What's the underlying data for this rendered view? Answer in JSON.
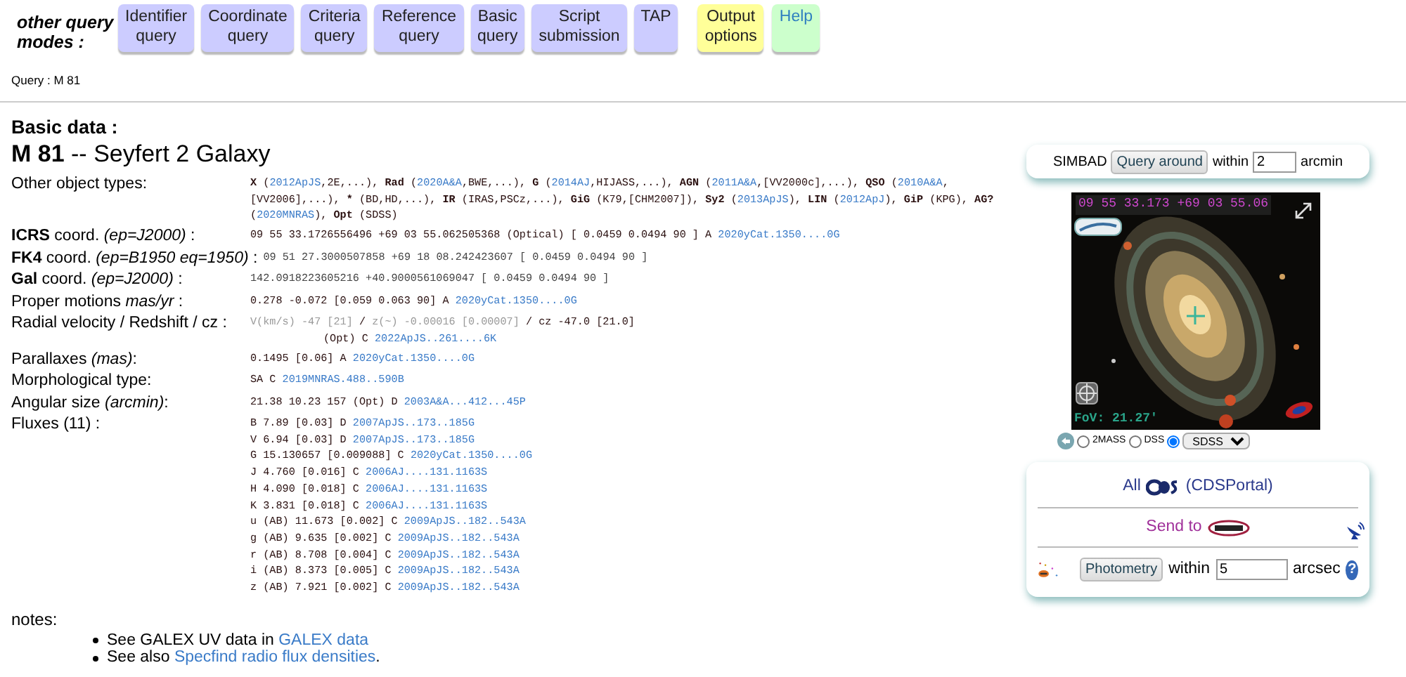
{
  "header": {
    "modes_label": "other query modes :",
    "buttons": [
      {
        "label": "Identifier query",
        "kind": "query",
        "color": "#ccccff"
      },
      {
        "label": "Coordinate query",
        "kind": "query",
        "color": "#ccccff"
      },
      {
        "label": "Criteria query",
        "kind": "query",
        "color": "#ccccff"
      },
      {
        "label": "Reference query",
        "kind": "query",
        "color": "#ccccff"
      },
      {
        "label": "Basic query",
        "kind": "query",
        "color": "#ccccff"
      },
      {
        "label": "Script submission",
        "kind": "query",
        "color": "#ccccff"
      },
      {
        "label": "TAP",
        "kind": "query",
        "color": "#ccccff"
      },
      {
        "label": "Output options",
        "kind": "options",
        "color": "#ffff99"
      },
      {
        "label": "Help",
        "kind": "help",
        "color": "#ccffcc"
      }
    ]
  },
  "query": "Query : M 81",
  "basic_data": {
    "heading": "Basic data :",
    "title": "**M 81** -- Seyfert 2 Galaxy",
    "rows": [
      {
        "label": "Other object types:",
        "lines": [
          {
            "indent": false,
            "segments": [
              {
                "kind": "bold",
                "text": "X"
              },
              {
                "kind": "text",
                "text": " ("
              },
              {
                "kind": "link",
                "text": "2012ApJS"
              },
              {
                "kind": "text",
                "text": ",2E,...), "
              },
              {
                "kind": "bold",
                "text": "Rad"
              },
              {
                "kind": "text",
                "text": " ("
              },
              {
                "kind": "link",
                "text": "2020A&A"
              },
              {
                "kind": "text",
                "text": ",BWE,...), "
              },
              {
                "kind": "bold",
                "text": "G"
              },
              {
                "kind": "text",
                "text": " ("
              },
              {
                "kind": "link",
                "text": "2014AJ"
              },
              {
                "kind": "text",
                "text": ",HIJASS,...), "
              },
              {
                "kind": "bold",
                "text": "AGN"
              },
              {
                "kind": "text",
                "text": " ("
              },
              {
                "kind": "link",
                "text": "2011A&A"
              },
              {
                "kind": "text",
                "text": ",[VV2000c],...), "
              },
              {
                "kind": "bold",
                "text": "QSO"
              },
              {
                "kind": "text",
                "text": " ("
              },
              {
                "kind": "link",
                "text": "2010A&A"
              },
              {
                "kind": "text",
                "text": ",[VV2006],...), "
              },
              {
                "kind": "bold",
                "text": "*"
              },
              {
                "kind": "text",
                "text": " (BD,HD,...), "
              },
              {
                "kind": "bold",
                "text": "IR"
              },
              {
                "kind": "text",
                "text": " (IRAS,PSCz,...), "
              },
              {
                "kind": "bold",
                "text": "GiG"
              },
              {
                "kind": "text",
                "text": " (K79,[CHM2007]), "
              },
              {
                "kind": "bold",
                "text": "Sy2"
              },
              {
                "kind": "text",
                "text": " ("
              },
              {
                "kind": "link",
                "text": "2013ApJS"
              },
              {
                "kind": "text",
                "text": "), "
              },
              {
                "kind": "bold",
                "text": "LIN"
              },
              {
                "kind": "text",
                "text": " ("
              },
              {
                "kind": "link",
                "text": "2012ApJ"
              },
              {
                "kind": "text",
                "text": "), "
              },
              {
                "kind": "bold",
                "text": "GiP"
              },
              {
                "kind": "text",
                "text": " (KPG), "
              },
              {
                "kind": "bold",
                "text": "AG?"
              },
              {
                "kind": "text",
                "text": " ("
              },
              {
                "kind": "link",
                "text": "2020MNRAS"
              },
              {
                "kind": "text",
                "text": "), "
              },
              {
                "kind": "bold",
                "text": "Opt"
              },
              {
                "kind": "text",
                "text": " (SDSS)"
              }
            ]
          }
        ]
      },
      {
        "label": "**ICRS** coord. *(ep=J2000)* :",
        "lines": [
          {
            "indent": false,
            "segments": [
              {
                "kind": "text",
                "text": "09 55 33.1726556496 +69 03 55.062505368 (Optical) [ 0.0459 0.0494 90 ] A "
              },
              {
                "kind": "link",
                "text": "2020yCat.1350....0G"
              }
            ]
          }
        ]
      },
      {
        "label": "**FK4** coord. *(ep=B1950 eq=1950)* :",
        "lines": [
          {
            "indent": false,
            "segments": [
              {
                "kind": "light",
                "text": "09 51 27.3000507858 +69 18 08.242423607 [ 0.0459 0.0494 90 ]"
              }
            ]
          }
        ]
      },
      {
        "label": "**Gal** coord. *(ep=J2000)* :",
        "lines": [
          {
            "indent": false,
            "segments": [
              {
                "kind": "light",
                "text": "142.0918223605216 +40.9000561069047 [ 0.0459 0.0494 90 ]"
              }
            ]
          }
        ]
      },
      {
        "label": "Proper motions *mas/yr* :",
        "lines": [
          {
            "indent": false,
            "segments": [
              {
                "kind": "text",
                "text": "0.278 -0.072 [0.059 0.063 90] A "
              },
              {
                "kind": "link",
                "text": "2020yCat.1350....0G"
              }
            ]
          }
        ]
      },
      {
        "label": "Radial velocity / Redshift / cz :",
        "lines": [
          {
            "indent": false,
            "segments": [
              {
                "kind": "muted",
                "text": "V(km/s) -47 [21]"
              },
              {
                "kind": "text",
                "text": " / "
              },
              {
                "kind": "muted",
                "text": "z(~) -0.00016 [0.00007]"
              },
              {
                "kind": "text",
                "text": " / cz -47.0 [21.0]"
              }
            ]
          },
          {
            "indent": true,
            "segments": [
              {
                "kind": "text",
                "text": "(Opt) C "
              },
              {
                "kind": "link",
                "text": "2022ApJS..261....6K"
              }
            ]
          }
        ]
      },
      {
        "label": "Parallaxes *(mas)*:",
        "lines": [
          {
            "indent": false,
            "segments": [
              {
                "kind": "text",
                "text": "0.1495 [0.06] A "
              },
              {
                "kind": "link",
                "text": "2020yCat.1350....0G"
              }
            ]
          }
        ]
      },
      {
        "label": "Morphological type:",
        "lines": [
          {
            "indent": false,
            "segments": [
              {
                "kind": "text",
                "text": "SA C "
              },
              {
                "kind": "link",
                "text": "2019MNRAS.488..590B"
              }
            ]
          }
        ]
      },
      {
        "label": "Angular size *(arcmin)*:",
        "lines": [
          {
            "indent": false,
            "segments": [
              {
                "kind": "text",
                "text": "21.38 10.23 157 (Opt) D "
              },
              {
                "kind": "link",
                "text": "2003A&A...412...45P"
              }
            ]
          }
        ]
      },
      {
        "label": "Fluxes (11) :",
        "lines": [
          {
            "indent": false,
            "segments": [
              {
                "kind": "text",
                "text": "B 7.89 [0.03] D "
              },
              {
                "kind": "link",
                "text": "2007ApJS..173..185G"
              }
            ]
          },
          {
            "indent": false,
            "segments": [
              {
                "kind": "text",
                "text": "V 6.94 [0.03] D "
              },
              {
                "kind": "link",
                "text": "2007ApJS..173..185G"
              }
            ]
          },
          {
            "indent": false,
            "segments": [
              {
                "kind": "text",
                "text": "G 15.130657 [0.009088] C "
              },
              {
                "kind": "link",
                "text": "2020yCat.1350....0G"
              }
            ]
          },
          {
            "indent": false,
            "segments": [
              {
                "kind": "text",
                "text": "J 4.760 [0.016] C "
              },
              {
                "kind": "link",
                "text": "2006AJ....131.1163S"
              }
            ]
          },
          {
            "indent": false,
            "segments": [
              {
                "kind": "text",
                "text": "H 4.090 [0.018] C "
              },
              {
                "kind": "link",
                "text": "2006AJ....131.1163S"
              }
            ]
          },
          {
            "indent": false,
            "segments": [
              {
                "kind": "text",
                "text": "K 3.831 [0.018] C "
              },
              {
                "kind": "link",
                "text": "2006AJ....131.1163S"
              }
            ]
          },
          {
            "indent": false,
            "segments": [
              {
                "kind": "text",
                "text": "u (AB) 11.673 [0.002] C "
              },
              {
                "kind": "link",
                "text": "2009ApJS..182..543A"
              }
            ]
          },
          {
            "indent": false,
            "segments": [
              {
                "kind": "text",
                "text": "g (AB) 9.635 [0.002] C "
              },
              {
                "kind": "link",
                "text": "2009ApJS..182..543A"
              }
            ]
          },
          {
            "indent": false,
            "segments": [
              {
                "kind": "text",
                "text": "r (AB) 8.708 [0.004] C "
              },
              {
                "kind": "link",
                "text": "2009ApJS..182..543A"
              }
            ]
          },
          {
            "indent": false,
            "segments": [
              {
                "kind": "text",
                "text": "i (AB) 8.373 [0.005] C "
              },
              {
                "kind": "link",
                "text": "2009ApJS..182..543A"
              }
            ]
          },
          {
            "indent": false,
            "segments": [
              {
                "kind": "text",
                "text": "z (AB) 7.921 [0.002] C "
              },
              {
                "kind": "link",
                "text": "2009ApJS..182..543A"
              }
            ]
          }
        ]
      }
    ]
  },
  "notes": {
    "title": "notes:",
    "items": [
      {
        "text": "See GALEX UV data in ",
        "link": "GALEX data"
      },
      {
        "text": "See also ",
        "link": "Specfind radio flux densities",
        "after": "."
      }
    ]
  },
  "query_around": {
    "label": "SIMBAD",
    "button": "Query around",
    "within": "within",
    "radius": "2",
    "unit": "arcmin"
  },
  "viewer": {
    "coordinates": "09 55 33.173 +69 03 55.06",
    "fov": "FoV: 21.27'",
    "surveys": [
      {
        "label": "2MASS",
        "selected": false
      },
      {
        "label": "DSS",
        "selected": false
      },
      {
        "selected": true
      }
    ],
    "survey_select": "SDSS"
  },
  "portal": {
    "all": "All",
    "portal_link": "(CDSPortal)",
    "send_to": "Send to",
    "photometry_button": "Photometry",
    "within": "within",
    "radius": "5",
    "unit": "arcsec",
    "help": "?"
  }
}
